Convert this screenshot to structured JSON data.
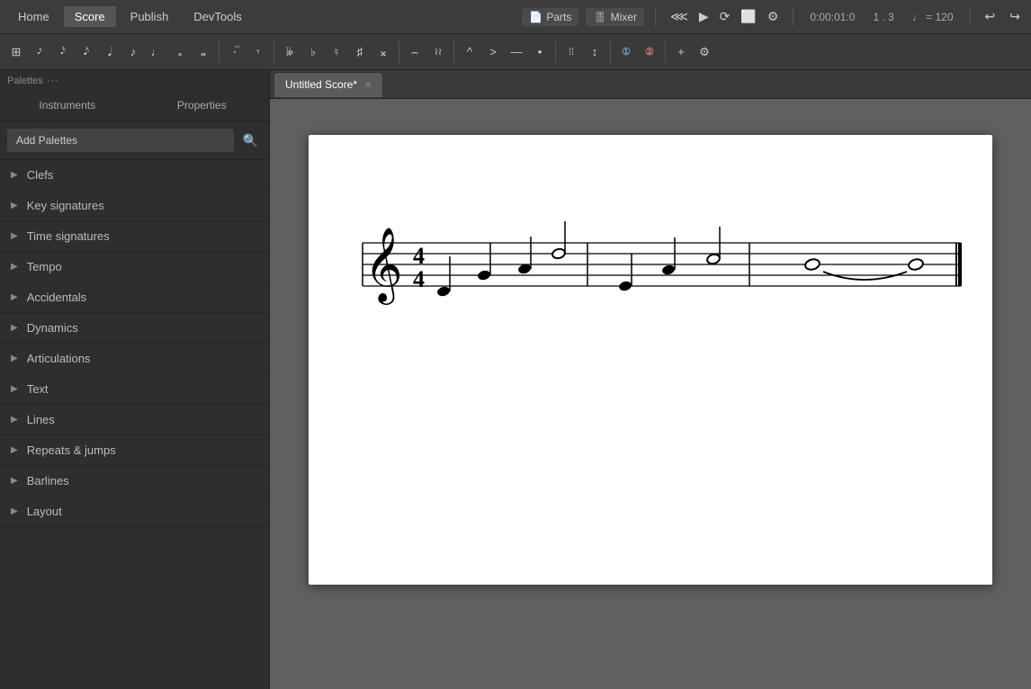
{
  "topbar": {
    "tabs": [
      {
        "label": "Home",
        "active": false
      },
      {
        "label": "Score",
        "active": true
      },
      {
        "label": "Publish",
        "active": false
      },
      {
        "label": "DevTools",
        "active": false
      }
    ],
    "parts_label": "Parts",
    "mixer_label": "Mixer",
    "transport": {
      "rewind": "⏮",
      "play": "▶",
      "loop": "🔁",
      "metro": "♩",
      "settings": "⚙"
    },
    "time": "0:00:01:0",
    "position": "1 . 3",
    "tempo_icon": "♩",
    "tempo": "= 120",
    "undo": "↩",
    "redo": "↪"
  },
  "toolbar": {
    "tools": [
      {
        "label": "≡",
        "name": "grid-icon"
      },
      {
        "label": "𝅘𝅥𝅯",
        "name": "grace-note-icon"
      },
      {
        "label": "𝅘𝅥𝅮",
        "name": "eighth-note-icon"
      },
      {
        "label": "𝅘𝅥",
        "name": "sixteenth-note-icon"
      },
      {
        "label": "♩",
        "name": "quarter-note-icon"
      },
      {
        "label": "♪",
        "name": "eighth-note2-icon"
      },
      {
        "label": "𝅗𝅥",
        "name": "half-note-icon"
      },
      {
        "label": "𝅝",
        "name": "whole-note-icon"
      },
      {
        "sep": true
      },
      {
        "label": "𝅘𝅥𝅮.",
        "name": "dotted-note-icon"
      },
      {
        "label": "𝄾",
        "name": "rest-icon"
      },
      {
        "sep": true
      },
      {
        "label": "𝄫",
        "name": "double-flat-icon"
      },
      {
        "label": "♭",
        "name": "flat-icon"
      },
      {
        "label": "♮",
        "name": "natural-icon"
      },
      {
        "label": "♯",
        "name": "sharp-icon"
      },
      {
        "label": "𝄪",
        "name": "double-sharp-icon"
      },
      {
        "sep": true
      },
      {
        "label": "𝄁",
        "name": "tie-icon"
      },
      {
        "label": "𝄃",
        "name": "slur-icon"
      },
      {
        "sep": true
      },
      {
        "label": "^",
        "name": "marcato-icon"
      },
      {
        "label": ">",
        "name": "accent-icon"
      },
      {
        "label": "—",
        "name": "tenuto-icon"
      },
      {
        "label": "•",
        "name": "staccato-icon"
      },
      {
        "sep": true
      },
      {
        "label": "𝄎",
        "name": "tremolo-icon"
      },
      {
        "label": "↕",
        "name": "flip-icon"
      },
      {
        "sep": true
      },
      {
        "label": "①",
        "name": "voice1-icon"
      },
      {
        "label": "②",
        "name": "voice2-icon"
      },
      {
        "sep": true
      },
      {
        "label": "+",
        "name": "add-icon"
      },
      {
        "label": "⚙",
        "name": "settings-icon"
      }
    ]
  },
  "sidebar": {
    "palettes_label": "Palettes",
    "palettes_dots": "···",
    "tabs": [
      {
        "label": "Instruments",
        "active": false
      },
      {
        "label": "Properties",
        "active": false
      }
    ],
    "add_button": "Add Palettes",
    "search_icon": "🔍",
    "items": [
      {
        "label": "Clefs",
        "expanded": false
      },
      {
        "label": "Key signatures",
        "expanded": false
      },
      {
        "label": "Time signatures",
        "expanded": false
      },
      {
        "label": "Tempo",
        "expanded": false
      },
      {
        "label": "Accidentals",
        "expanded": false
      },
      {
        "label": "Dynamics",
        "expanded": false
      },
      {
        "label": "Articulations",
        "expanded": false
      },
      {
        "label": "Text",
        "expanded": false
      },
      {
        "label": "Lines",
        "expanded": false
      },
      {
        "label": "Repeats & jumps",
        "expanded": false
      },
      {
        "label": "Barlines",
        "expanded": false
      },
      {
        "label": "Layout",
        "expanded": false
      }
    ]
  },
  "score": {
    "tab_title": "Untitled Score*",
    "close_icon": "×"
  },
  "colors": {
    "active_tab": "#6a9fd8",
    "bg_dark": "#2b2b2b",
    "toolbar_bg": "#3a3a3a",
    "sidebar_bg": "#2e2e2e"
  }
}
